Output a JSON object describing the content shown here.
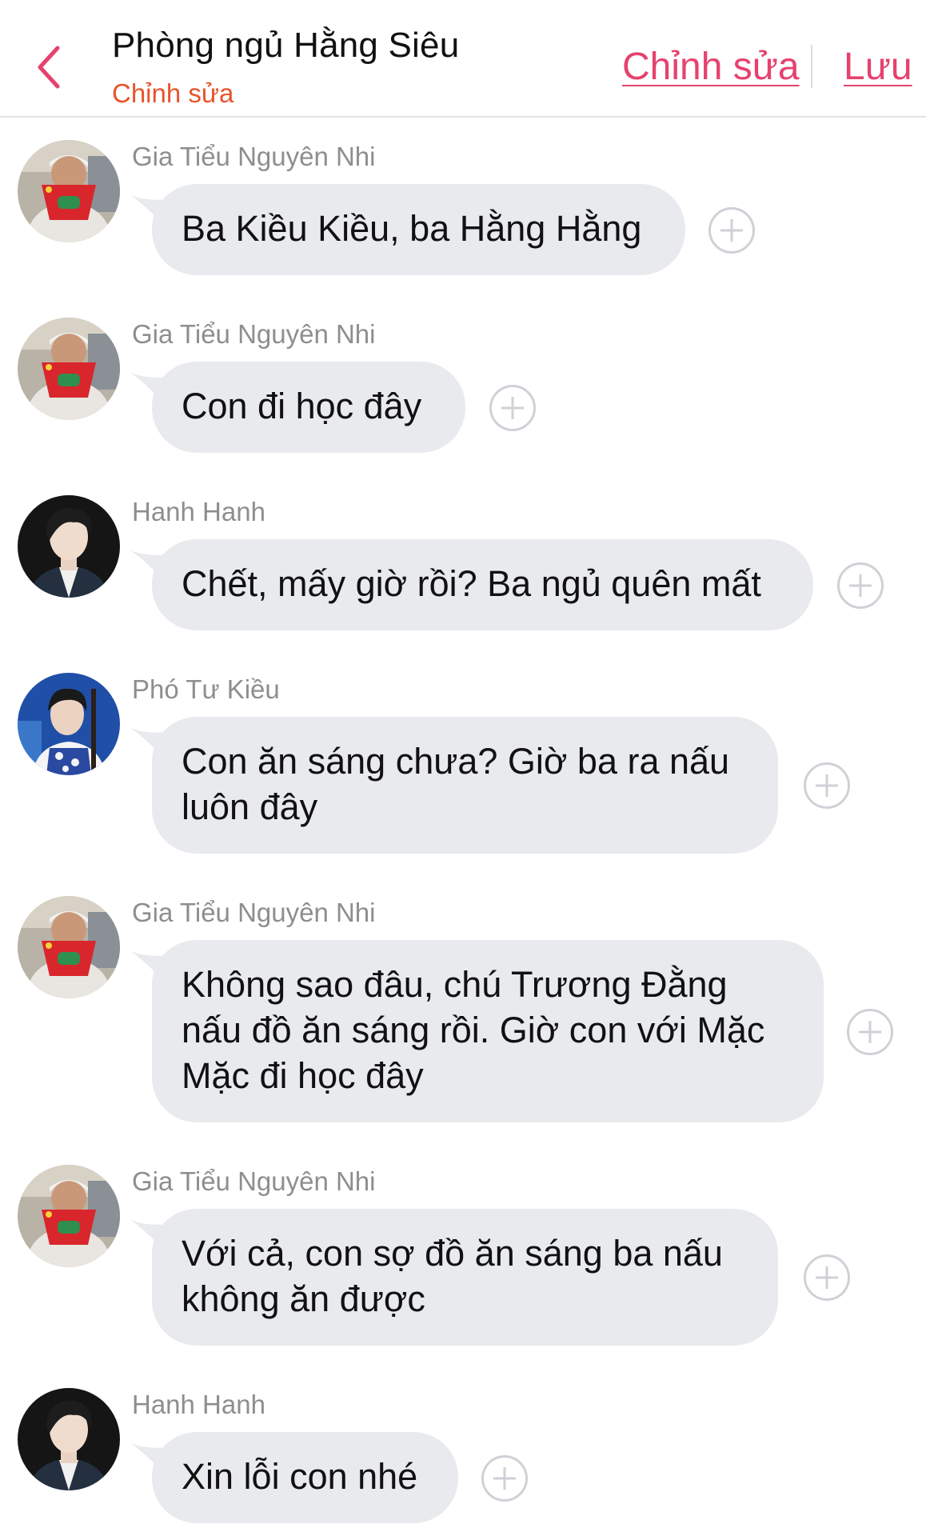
{
  "header": {
    "title": "Phòng ngủ Hằng Siêu",
    "subtitle": "Chỉnh sửa",
    "edit_label": "Chỉnh sửa",
    "save_label": "Lưu",
    "back_icon": "chevron-left-icon",
    "accent_color": "#e6426e"
  },
  "messages": [
    {
      "sender": "Gia Tiểu Nguyên Nhi",
      "avatar": "child-avatar",
      "lines": [
        "Ba Kiều Kiều, ba Hằng Hằng"
      ]
    },
    {
      "sender": "Gia Tiểu Nguyên Nhi",
      "avatar": "child-avatar",
      "lines": [
        "Con đi học đây"
      ]
    },
    {
      "sender": "Hanh Hanh",
      "avatar": "man-dark-avatar",
      "lines": [
        "Chết, mấy giờ rồi? Ba ngủ quên mất"
      ]
    },
    {
      "sender": "Phó Tư Kiều",
      "avatar": "man-blue-avatar",
      "lines": [
        "Con ăn sáng chưa? Giờ ba ra nấu",
        "luôn đây"
      ]
    },
    {
      "sender": "Gia Tiểu Nguyên Nhi",
      "avatar": "child-avatar",
      "lines": [
        "Không sao đâu, chú Trương Đằng",
        "nấu đồ ăn sáng rồi. Giờ con với Mặc",
        "Mặc đi học đây"
      ]
    },
    {
      "sender": "Gia Tiểu Nguyên Nhi",
      "avatar": "child-avatar",
      "lines": [
        "Với cả, con sợ đồ ăn sáng ba nấu",
        "không ăn được"
      ]
    },
    {
      "sender": "Hanh Hanh",
      "avatar": "man-dark-avatar",
      "lines": [
        "Xin lỗi con nhé"
      ]
    }
  ]
}
